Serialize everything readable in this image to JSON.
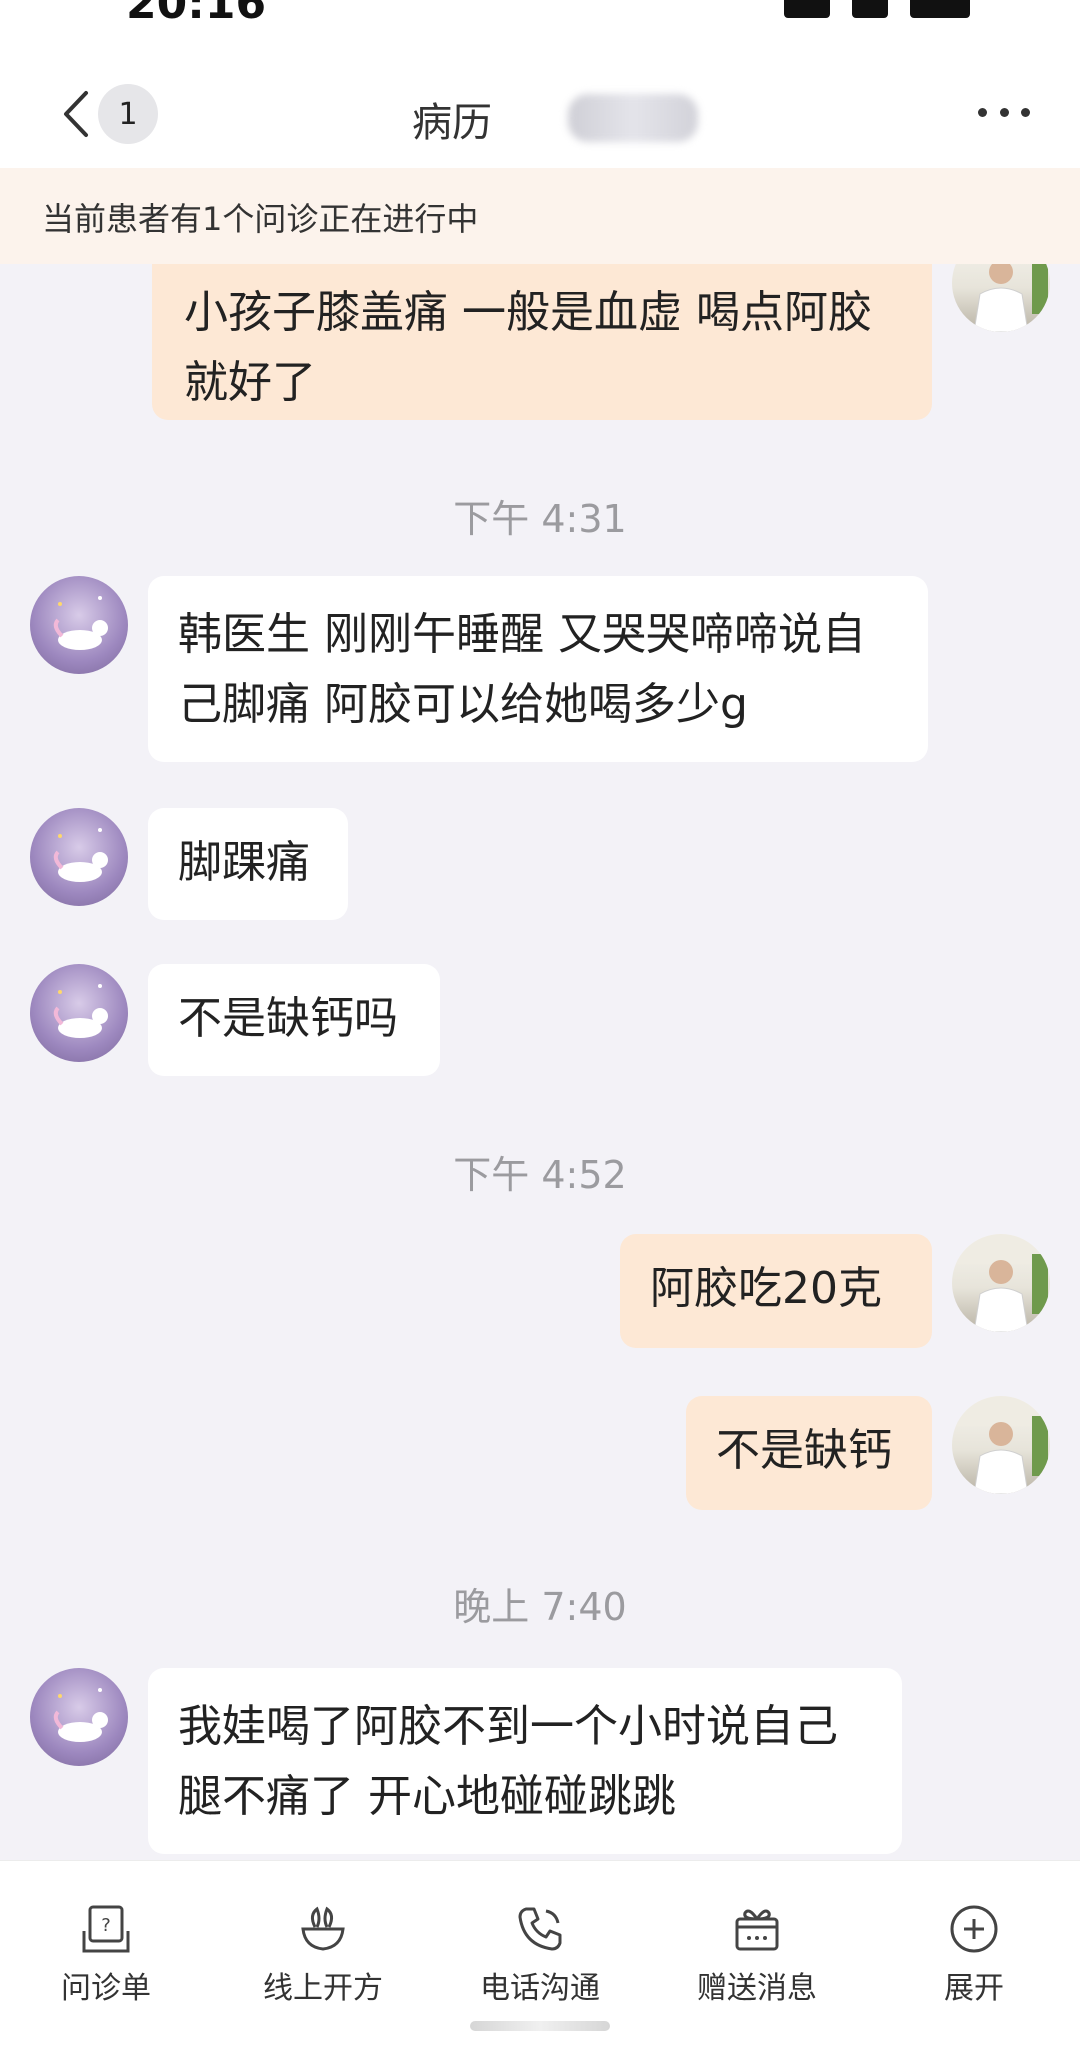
{
  "status_bar": {
    "time": "20:16"
  },
  "nav": {
    "back_badge": "1",
    "tab_record": "病历",
    "tab_patient_blurred": ""
  },
  "notice": {
    "text": "当前患者有1个问诊正在进行中"
  },
  "messages": {
    "m0": {
      "line1": "小孩子膝盖痛 一般是血虚 喝点阿胶",
      "line2": "就好了"
    },
    "ts1": "下午 4:31",
    "m1": {
      "line1": "韩医生 刚刚午睡醒 又哭哭啼啼说自",
      "line2": "己脚痛 阿胶可以给她喝多少g"
    },
    "m2": "脚踝痛",
    "m3": "不是缺钙吗",
    "ts2": "下午 4:52",
    "m4": "阿胶吃20克",
    "m5": "不是缺钙",
    "ts3": "晚上 7:40",
    "m6": {
      "line1": "我娃喝了阿胶不到一个小时说自己",
      "line2": "腿不痛了 开心地碰碰跳跳"
    }
  },
  "toolbar": {
    "items": [
      {
        "label": "问诊单",
        "icon": "questionnaire-icon"
      },
      {
        "label": "线上开方",
        "icon": "herb-bowl-icon"
      },
      {
        "label": "电话沟通",
        "icon": "phone-icon"
      },
      {
        "label": "赠送消息",
        "icon": "gift-icon"
      },
      {
        "label": "展开",
        "icon": "plus-circle-icon"
      }
    ]
  },
  "colors": {
    "accent": "#e54d4d",
    "outgoing_bubble": "#fde8d5",
    "incoming_bubble": "#ffffff",
    "chat_bg": "#f3f2f7",
    "notice_bg": "#fcf3ec"
  }
}
